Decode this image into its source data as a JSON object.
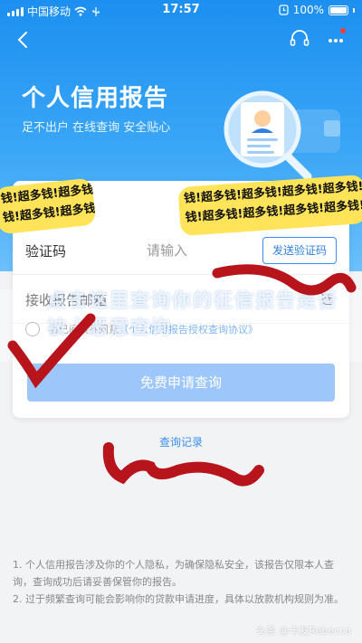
{
  "status_bar": {
    "carrier": "中国移动",
    "time": "17:57",
    "battery": "100%"
  },
  "colors": {
    "primary": "#1c8ff0",
    "button_disabled": "#9dc7fa",
    "link": "#3a8ef0",
    "sticker": "#ffe45a",
    "scribble": "#b8141c"
  },
  "icons": {
    "back": "chevron-left-icon",
    "service": "headset-icon",
    "more": "more-dots-icon"
  },
  "header": {
    "title": "个人信用报告",
    "subtitle": "足不出户 在线查询 安全贴心"
  },
  "form": {
    "code": {
      "label": "验证码",
      "placeholder": "请输入",
      "send_label": "发送验证码"
    },
    "email": {
      "label": "接收报告邮箱",
      "suffix": "选"
    },
    "agreement": {
      "prefix": "我已阅读并同意",
      "link": "《个人信用报告授权查询协议》"
    },
    "submit_label": "免费申请查询"
  },
  "history_link": "查询记录",
  "notes": [
    "1. 个人信用报告涉及你的个人隐私，为确保隐私安全，该报告仅限本人查询，查询成功后请妥善保管你的报告。",
    "2. 过于频繁查询可能会影响你的贷款申请进度，具体以放款机构规则为准。"
  ],
  "overlay": {
    "sticker_line": "钱!超多钱!超多钱!超多钱!超多钱!",
    "banner_text": "点击这里查询你的征信报告是否被人恶意查询"
  },
  "watermark": "头条 @卡友Rebecca"
}
